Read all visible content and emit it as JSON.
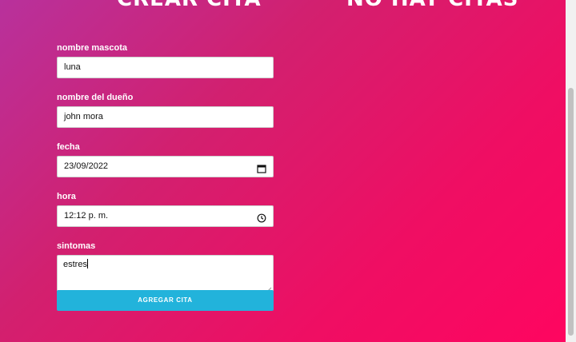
{
  "headings": {
    "create_title": "CREAR CITA",
    "list_title": "NO HAY CITAS"
  },
  "form": {
    "pet_name": {
      "label": "nombre mascota",
      "value": "luna"
    },
    "owner_name": {
      "label": "nombre del dueño",
      "value": "john mora"
    },
    "date": {
      "label": "fecha",
      "value": "23/09/2022",
      "icon": "calendar-icon"
    },
    "time": {
      "label": "hora",
      "value": "12:12 p. m.",
      "icon": "clock-icon"
    },
    "symptoms": {
      "label": "sintomas",
      "value": "estres"
    },
    "submit_label": "AGREGAR CITA"
  },
  "colors": {
    "gradient_start": "#b8319c",
    "gradient_end": "#ff0560",
    "button": "#22b3db"
  }
}
